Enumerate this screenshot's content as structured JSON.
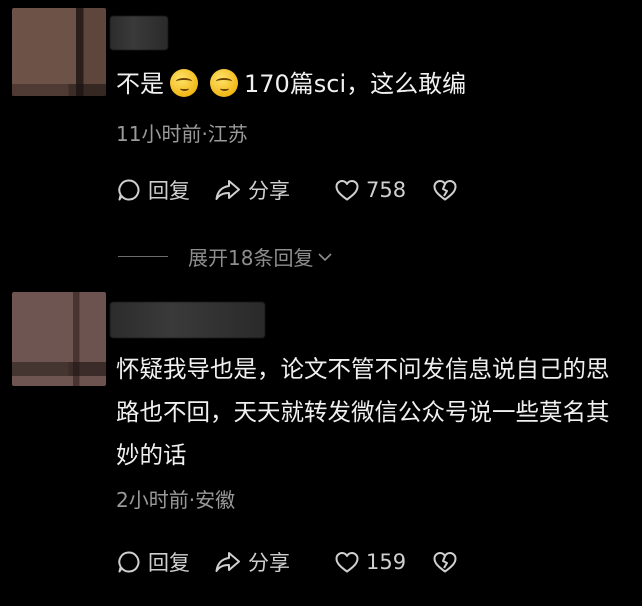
{
  "comments": [
    {
      "text_part1": "不是",
      "emoji_1": "smile-emoji",
      "emoji_2": "smile-emoji",
      "text_part2": "170篇sci，这么敢编",
      "meta": "11小时前·江苏",
      "reply_label": "回复",
      "share_label": "分享",
      "like_count": "758",
      "expand_label": "展开18条回复"
    },
    {
      "text": "怀疑我导也是，论文不管不问发信息说自己的思路也不回，天天就转发微信公众号说一些莫名其妙的话",
      "meta": "2小时前·安徽",
      "reply_label": "回复",
      "share_label": "分享",
      "like_count": "159"
    }
  ]
}
